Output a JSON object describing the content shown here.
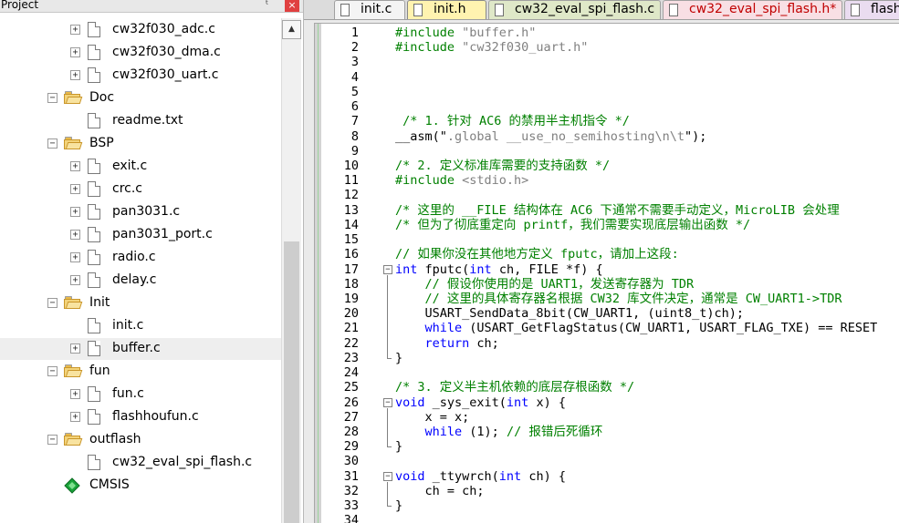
{
  "project_panel": {
    "title": "Project",
    "pin_glyph": "ᵗ",
    "close_glyph": "×",
    "scroll_up_glyph": "▲",
    "tree": [
      {
        "type": "file",
        "label": "cw32f030_adc.c",
        "depth": 2,
        "expander": "+"
      },
      {
        "type": "file",
        "label": "cw32f030_dma.c",
        "depth": 2,
        "expander": "+"
      },
      {
        "type": "file",
        "label": "cw32f030_uart.c",
        "depth": 2,
        "expander": "+"
      },
      {
        "type": "folder",
        "label": "Doc",
        "expander": "−"
      },
      {
        "type": "file",
        "label": "readme.txt",
        "depth": 2,
        "expander": ""
      },
      {
        "type": "folder",
        "label": "BSP",
        "expander": "−"
      },
      {
        "type": "file",
        "label": "exit.c",
        "depth": 2,
        "expander": "+"
      },
      {
        "type": "file",
        "label": "crc.c",
        "depth": 2,
        "expander": "+"
      },
      {
        "type": "file",
        "label": "pan3031.c",
        "depth": 2,
        "expander": "+"
      },
      {
        "type": "file",
        "label": "pan3031_port.c",
        "depth": 2,
        "expander": "+"
      },
      {
        "type": "file",
        "label": "radio.c",
        "depth": 2,
        "expander": "+"
      },
      {
        "type": "file",
        "label": "delay.c",
        "depth": 2,
        "expander": "+"
      },
      {
        "type": "folder",
        "label": "Init",
        "expander": "−"
      },
      {
        "type": "file",
        "label": "init.c",
        "depth": 2,
        "expander": ""
      },
      {
        "type": "file",
        "label": "buffer.c",
        "depth": 2,
        "expander": "+",
        "selected": true
      },
      {
        "type": "folder",
        "label": "fun",
        "expander": "−"
      },
      {
        "type": "file",
        "label": "fun.c",
        "depth": 2,
        "expander": "+"
      },
      {
        "type": "file",
        "label": "flashhoufun.c",
        "depth": 2,
        "expander": "+"
      },
      {
        "type": "folder",
        "label": "outflash",
        "expander": "−"
      },
      {
        "type": "file",
        "label": "cw32_eval_spi_flash.c",
        "depth": 2,
        "expander": ""
      },
      {
        "type": "component",
        "label": "CMSIS",
        "expander": ""
      }
    ]
  },
  "tabs": [
    {
      "label": "init.c",
      "bg": "#f4f4f4",
      "active": false
    },
    {
      "label": "init.h",
      "bg": "#fff3b0",
      "active": true
    },
    {
      "label": "cw32_eval_spi_flash.c",
      "bg": "#dfe8c8",
      "active": false
    },
    {
      "label": "cw32_eval_spi_flash.h*",
      "bg": "#f8dfe4",
      "active": false
    },
    {
      "label": "flash",
      "bg": "#eadcf0",
      "active": false
    }
  ],
  "tab_text_colors": {
    "default": "#000000",
    "modified": "#c00000"
  },
  "colors": {
    "keyword": "#0000ff",
    "comment": "#008000",
    "string": "#808080",
    "selection": "#eeeeee"
  },
  "code_lines": [
    {
      "n": "1",
      "segs": [
        {
          "c": "pp",
          "t": "#include "
        },
        {
          "c": "str",
          "t": "\"buffer.h\""
        }
      ]
    },
    {
      "n": "2",
      "segs": [
        {
          "c": "pp",
          "t": "#include "
        },
        {
          "c": "str",
          "t": "\"cw32f030_uart.h\""
        }
      ]
    },
    {
      "n": "3",
      "segs": []
    },
    {
      "n": "4",
      "segs": []
    },
    {
      "n": "5",
      "segs": []
    },
    {
      "n": "6",
      "segs": []
    },
    {
      "n": "7",
      "segs": [
        {
          "c": "cm",
          "t": " /* 1. 针对 AC6 的禁用半主机指令 */"
        }
      ]
    },
    {
      "n": "8",
      "segs": [
        {
          "c": "",
          "t": "__asm(\""
        },
        {
          "c": "str",
          "t": ".global __use_no_semihosting\\n\\t"
        },
        {
          "c": "",
          "t": "\");"
        }
      ]
    },
    {
      "n": "9",
      "segs": []
    },
    {
      "n": "10",
      "segs": [
        {
          "c": "cm",
          "t": "/* 2. 定义标准库需要的支持函数 */"
        }
      ]
    },
    {
      "n": "11",
      "segs": [
        {
          "c": "pp",
          "t": "#include "
        },
        {
          "c": "str",
          "t": "<stdio.h>"
        }
      ]
    },
    {
      "n": "12",
      "segs": []
    },
    {
      "n": "13",
      "segs": [
        {
          "c": "cm",
          "t": "/* 这里的 __FILE 结构体在 AC6 下通常不需要手动定义，MicroLIB 会处理"
        }
      ]
    },
    {
      "n": "14",
      "segs": [
        {
          "c": "cm",
          "t": "/* 但为了彻底重定向 printf，我们需要实现底层输出函数 */"
        }
      ]
    },
    {
      "n": "15",
      "segs": []
    },
    {
      "n": "16",
      "segs": [
        {
          "c": "cm",
          "t": "// 如果你没在其他地方定义 fputc，请加上这段:"
        }
      ]
    },
    {
      "n": "17",
      "fold": "−",
      "segs": [
        {
          "c": "kw",
          "t": "int"
        },
        {
          "c": "",
          "t": " fputc("
        },
        {
          "c": "kw",
          "t": "int"
        },
        {
          "c": "",
          "t": " ch, FILE *f) {"
        }
      ]
    },
    {
      "n": "18",
      "segs": [
        {
          "c": "cm",
          "t": "    // 假设你使用的是 UART1，发送寄存器为 TDR"
        }
      ]
    },
    {
      "n": "19",
      "segs": [
        {
          "c": "cm",
          "t": "    // 这里的具体寄存器名根据 CW32 库文件决定，通常是 CW_UART1->TDR"
        }
      ]
    },
    {
      "n": "20",
      "segs": [
        {
          "c": "",
          "t": "    USART_SendData_8bit(CW_UART1, (uint8_t)ch);"
        }
      ]
    },
    {
      "n": "21",
      "segs": [
        {
          "c": "",
          "t": "    "
        },
        {
          "c": "kw",
          "t": "while"
        },
        {
          "c": "",
          "t": " (USART_GetFlagStatus(CW_UART1, USART_FLAG_TXE) == RESET"
        }
      ]
    },
    {
      "n": "22",
      "segs": [
        {
          "c": "",
          "t": "    "
        },
        {
          "c": "kw",
          "t": "return"
        },
        {
          "c": "",
          "t": " ch;"
        }
      ]
    },
    {
      "n": "23",
      "segs": [
        {
          "c": "",
          "t": "}"
        }
      ]
    },
    {
      "n": "24",
      "segs": []
    },
    {
      "n": "25",
      "segs": [
        {
          "c": "cm",
          "t": "/* 3. 定义半主机依赖的底层存根函数 */"
        }
      ]
    },
    {
      "n": "26",
      "fold": "−",
      "segs": [
        {
          "c": "kw",
          "t": "void"
        },
        {
          "c": "",
          "t": " _sys_exit("
        },
        {
          "c": "kw",
          "t": "int"
        },
        {
          "c": "",
          "t": " x) {"
        }
      ]
    },
    {
      "n": "27",
      "segs": [
        {
          "c": "",
          "t": "    x = x;"
        }
      ]
    },
    {
      "n": "28",
      "segs": [
        {
          "c": "",
          "t": "    "
        },
        {
          "c": "kw",
          "t": "while"
        },
        {
          "c": "",
          "t": " (1); "
        },
        {
          "c": "cm",
          "t": "// 报错后死循环"
        }
      ]
    },
    {
      "n": "29",
      "segs": [
        {
          "c": "",
          "t": "}"
        }
      ]
    },
    {
      "n": "30",
      "segs": []
    },
    {
      "n": "31",
      "fold": "−",
      "segs": [
        {
          "c": "kw",
          "t": "void"
        },
        {
          "c": "",
          "t": " _ttywrch("
        },
        {
          "c": "kw",
          "t": "int"
        },
        {
          "c": "",
          "t": " ch) {"
        }
      ]
    },
    {
      "n": "32",
      "segs": [
        {
          "c": "",
          "t": "    ch = ch;"
        }
      ]
    },
    {
      "n": "33",
      "segs": [
        {
          "c": "",
          "t": "}"
        }
      ]
    },
    {
      "n": "34",
      "segs": []
    }
  ]
}
